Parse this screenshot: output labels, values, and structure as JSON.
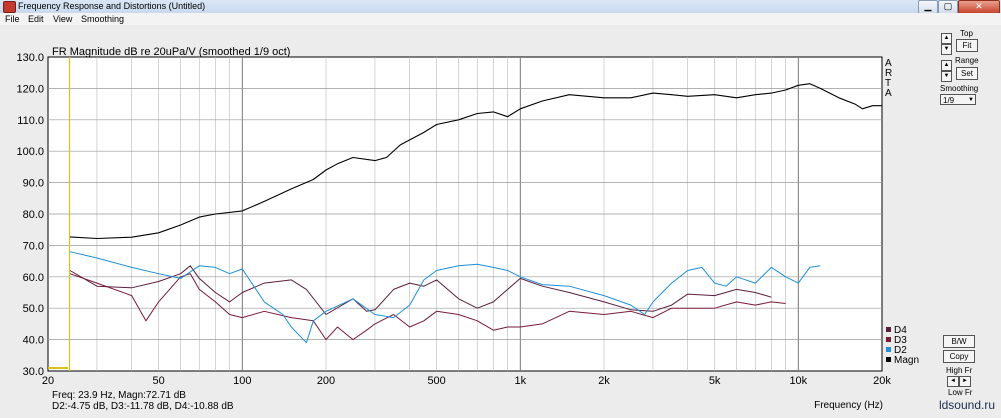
{
  "window": {
    "title": "Frequency Response and Distortions (Untitled)",
    "minimize_glyph": "▁",
    "maximize_glyph": "▢",
    "close_glyph": "✕"
  },
  "menu": [
    "File",
    "Edit",
    "View",
    "Smoothing"
  ],
  "arta_vertical": [
    "A",
    "R",
    "T",
    "A"
  ],
  "side_panel": {
    "top_label": "Top",
    "fit_label": "Fit",
    "range_label": "Range",
    "set_label": "Set",
    "smoothing_label": "Smoothing",
    "smoothing_value": "1/9",
    "bw_label": "B/W",
    "copy_label": "Copy",
    "highfr_label": "High Fr",
    "lowfr_label": "Low Fr",
    "up_glyph": "▲",
    "down_glyph": "▼",
    "left_glyph": "◄",
    "right_glyph": "►"
  },
  "readout": {
    "line1": "Freq: 23.9 Hz, Magn:72.71 dB",
    "line2": "D2:-4.75 dB, D3:-11.78 dB, D4:-10.88 dB"
  },
  "watermark": "ldsound.ru",
  "colors": {
    "magn": "#000000",
    "d2": "#1e8fd8",
    "d3": "#7a1a36",
    "d4": "#5a1f3c",
    "cursor": "#d8c21a"
  },
  "chart_data": {
    "type": "line",
    "title": "FR Magnitude dB re 20uPa/V (smoothed 1/9 oct)",
    "xlabel": "Frequency (Hz)",
    "ylabel": "",
    "xscale": "log",
    "xlim": [
      20,
      20000
    ],
    "ylim": [
      30,
      130
    ],
    "yticks": [
      "30.0",
      "40.0",
      "50.0",
      "60.0",
      "70.0",
      "80.0",
      "90.0",
      "100.0",
      "110.0",
      "120.0",
      "130.0"
    ],
    "xticks": [
      {
        "v": 20,
        "label": "20"
      },
      {
        "v": 50,
        "label": "50"
      },
      {
        "v": 100,
        "label": "100"
      },
      {
        "v": 200,
        "label": "200"
      },
      {
        "v": 500,
        "label": "500"
      },
      {
        "v": 1000,
        "label": "1k"
      },
      {
        "v": 2000,
        "label": "2k"
      },
      {
        "v": 5000,
        "label": "5k"
      },
      {
        "v": 10000,
        "label": "10k"
      },
      {
        "v": 20000,
        "label": "20k"
      }
    ],
    "grid": true,
    "legend_position": "bottom-right",
    "cursor_x": 23.9,
    "series": [
      {
        "name": "Magn",
        "key": "magn",
        "points": [
          [
            24,
            72.7
          ],
          [
            30,
            72.2
          ],
          [
            40,
            72.6
          ],
          [
            50,
            74
          ],
          [
            60,
            76.5
          ],
          [
            70,
            79
          ],
          [
            80,
            80
          ],
          [
            100,
            81
          ],
          [
            120,
            84
          ],
          [
            150,
            88
          ],
          [
            180,
            91
          ],
          [
            200,
            94
          ],
          [
            220,
            96
          ],
          [
            250,
            98
          ],
          [
            300,
            97
          ],
          [
            330,
            98
          ],
          [
            370,
            102
          ],
          [
            450,
            106
          ],
          [
            500,
            108.5
          ],
          [
            600,
            110
          ],
          [
            700,
            112
          ],
          [
            800,
            112.5
          ],
          [
            900,
            111
          ],
          [
            1000,
            113.5
          ],
          [
            1200,
            116
          ],
          [
            1500,
            118
          ],
          [
            2000,
            117
          ],
          [
            2500,
            117
          ],
          [
            3000,
            118.5
          ],
          [
            3500,
            118
          ],
          [
            4000,
            117.5
          ],
          [
            5000,
            118
          ],
          [
            6000,
            117
          ],
          [
            7000,
            118
          ],
          [
            8000,
            118.5
          ],
          [
            9000,
            119.5
          ],
          [
            10000,
            121
          ],
          [
            11000,
            121.5
          ],
          [
            12000,
            120
          ],
          [
            14000,
            117
          ],
          [
            16000,
            115
          ],
          [
            17000,
            113.5
          ],
          [
            18500,
            114.5
          ],
          [
            20000,
            114.5
          ]
        ]
      },
      {
        "name": "D2",
        "key": "d2",
        "points": [
          [
            24,
            68
          ],
          [
            30,
            66
          ],
          [
            40,
            63
          ],
          [
            50,
            61
          ],
          [
            60,
            59.5
          ],
          [
            70,
            63.5
          ],
          [
            80,
            63
          ],
          [
            90,
            61
          ],
          [
            100,
            62.5
          ],
          [
            110,
            57
          ],
          [
            120,
            52
          ],
          [
            140,
            48
          ],
          [
            150,
            44
          ],
          [
            170,
            39
          ],
          [
            180,
            46
          ],
          [
            200,
            49
          ],
          [
            250,
            53
          ],
          [
            300,
            48
          ],
          [
            350,
            47
          ],
          [
            400,
            51
          ],
          [
            450,
            59
          ],
          [
            500,
            62
          ],
          [
            600,
            63.5
          ],
          [
            700,
            64
          ],
          [
            800,
            63
          ],
          [
            900,
            62
          ],
          [
            1000,
            60
          ],
          [
            1200,
            57.5
          ],
          [
            1500,
            57
          ],
          [
            2000,
            54
          ],
          [
            2500,
            51
          ],
          [
            2800,
            48
          ],
          [
            3000,
            52
          ],
          [
            3500,
            58
          ],
          [
            4000,
            62
          ],
          [
            4500,
            63
          ],
          [
            5000,
            58
          ],
          [
            5500,
            57
          ],
          [
            6000,
            60
          ],
          [
            7000,
            58
          ],
          [
            8000,
            63
          ],
          [
            9000,
            60
          ],
          [
            10000,
            58
          ],
          [
            11000,
            63
          ],
          [
            12000,
            63.5
          ]
        ]
      },
      {
        "name": "D3",
        "key": "d3",
        "points": [
          [
            24,
            61
          ],
          [
            30,
            58
          ],
          [
            40,
            54
          ],
          [
            45,
            46
          ],
          [
            50,
            52
          ],
          [
            60,
            60
          ],
          [
            65,
            61
          ],
          [
            70,
            56
          ],
          [
            80,
            52
          ],
          [
            90,
            48
          ],
          [
            100,
            47
          ],
          [
            120,
            49
          ],
          [
            150,
            47
          ],
          [
            180,
            46
          ],
          [
            200,
            40
          ],
          [
            220,
            44
          ],
          [
            250,
            40
          ],
          [
            280,
            43
          ],
          [
            300,
            45
          ],
          [
            350,
            48
          ],
          [
            400,
            44
          ],
          [
            450,
            46
          ],
          [
            500,
            49
          ],
          [
            600,
            48
          ],
          [
            700,
            46
          ],
          [
            800,
            43
          ],
          [
            900,
            44
          ],
          [
            1000,
            44
          ],
          [
            1200,
            45
          ],
          [
            1500,
            49
          ],
          [
            2000,
            48
          ],
          [
            2500,
            49
          ],
          [
            3000,
            47
          ],
          [
            3500,
            50
          ],
          [
            4000,
            50
          ],
          [
            5000,
            50
          ],
          [
            6000,
            52
          ],
          [
            7000,
            51
          ],
          [
            8000,
            52
          ],
          [
            9000,
            51.5
          ]
        ]
      },
      {
        "name": "D4",
        "key": "d4",
        "points": [
          [
            24,
            62
          ],
          [
            30,
            57
          ],
          [
            40,
            56.5
          ],
          [
            50,
            58.5
          ],
          [
            60,
            61
          ],
          [
            65,
            63.5
          ],
          [
            70,
            59.5
          ],
          [
            80,
            55
          ],
          [
            90,
            52
          ],
          [
            100,
            55
          ],
          [
            120,
            58
          ],
          [
            150,
            59
          ],
          [
            170,
            56
          ],
          [
            200,
            48
          ],
          [
            250,
            53
          ],
          [
            280,
            49
          ],
          [
            300,
            49.5
          ],
          [
            350,
            56
          ],
          [
            400,
            58
          ],
          [
            450,
            57
          ],
          [
            500,
            59
          ],
          [
            600,
            53
          ],
          [
            700,
            50
          ],
          [
            800,
            52
          ],
          [
            900,
            56
          ],
          [
            1000,
            59.5
          ],
          [
            1200,
            57
          ],
          [
            1500,
            55
          ],
          [
            2000,
            52
          ],
          [
            2500,
            49.5
          ],
          [
            3000,
            49
          ],
          [
            3500,
            51
          ],
          [
            4000,
            54.5
          ],
          [
            5000,
            54
          ],
          [
            6000,
            56
          ],
          [
            7000,
            55
          ],
          [
            8000,
            53.5
          ]
        ]
      }
    ]
  }
}
